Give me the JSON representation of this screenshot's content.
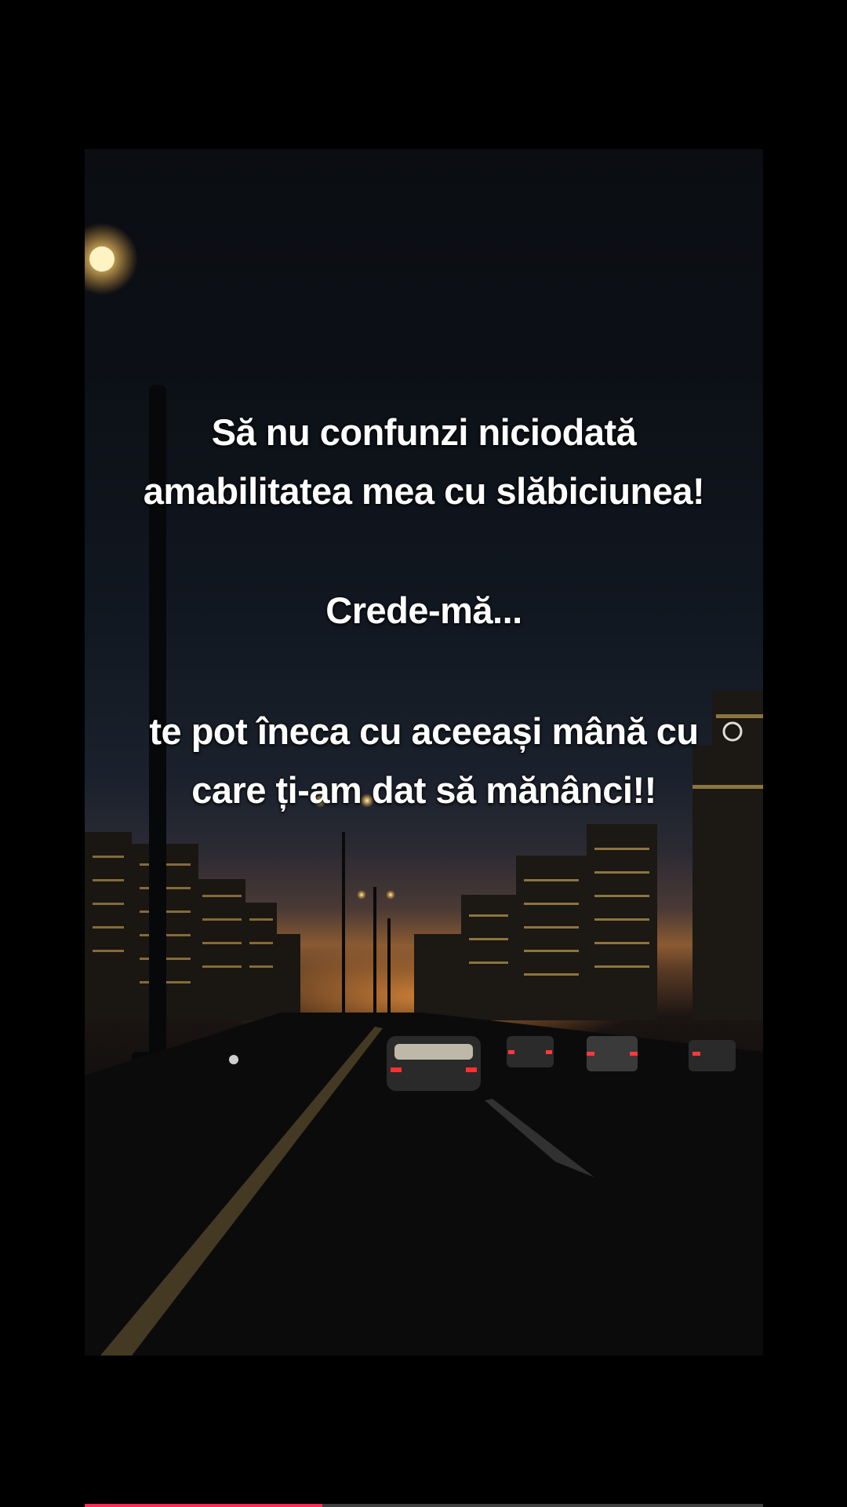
{
  "caption": {
    "line1": "Să nu confunzi niciodată",
    "line2": "amabilitatea mea cu slăbiciunea!",
    "line3": "Crede-mă...",
    "line4": "te pot îneca cu aceeași mână cu",
    "line5": "care ți-am dat să mănânci!!"
  },
  "playback": {
    "progress": 0.35
  },
  "colors": {
    "accent": "#ff2b55",
    "text": "#ffffff",
    "background": "#000000"
  }
}
